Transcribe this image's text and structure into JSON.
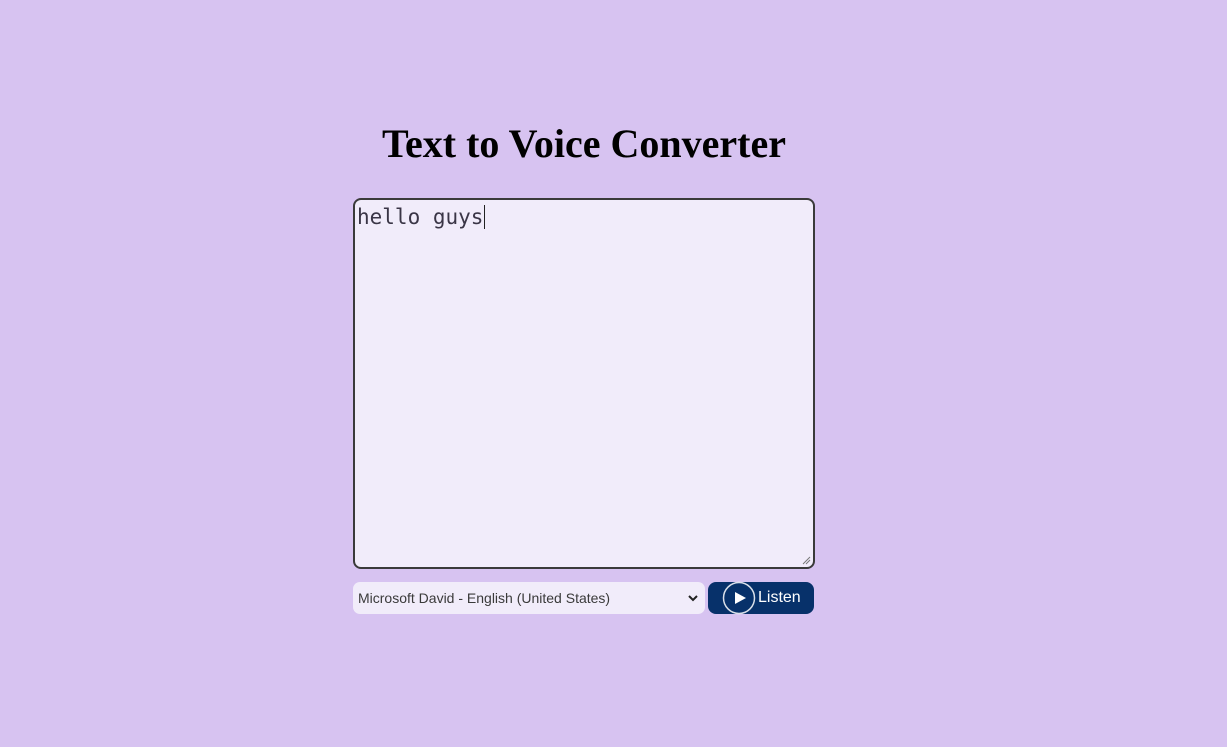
{
  "page": {
    "title": "Text to Voice Converter"
  },
  "editor": {
    "value": "hello guys"
  },
  "voice": {
    "selected": "Microsoft David - English (United States)"
  },
  "listen_button": {
    "label": "Listen",
    "icon": "play-icon"
  },
  "colors": {
    "background": "#d7c3f1",
    "field_background": "#f1ecfa",
    "button": "#07316a"
  }
}
